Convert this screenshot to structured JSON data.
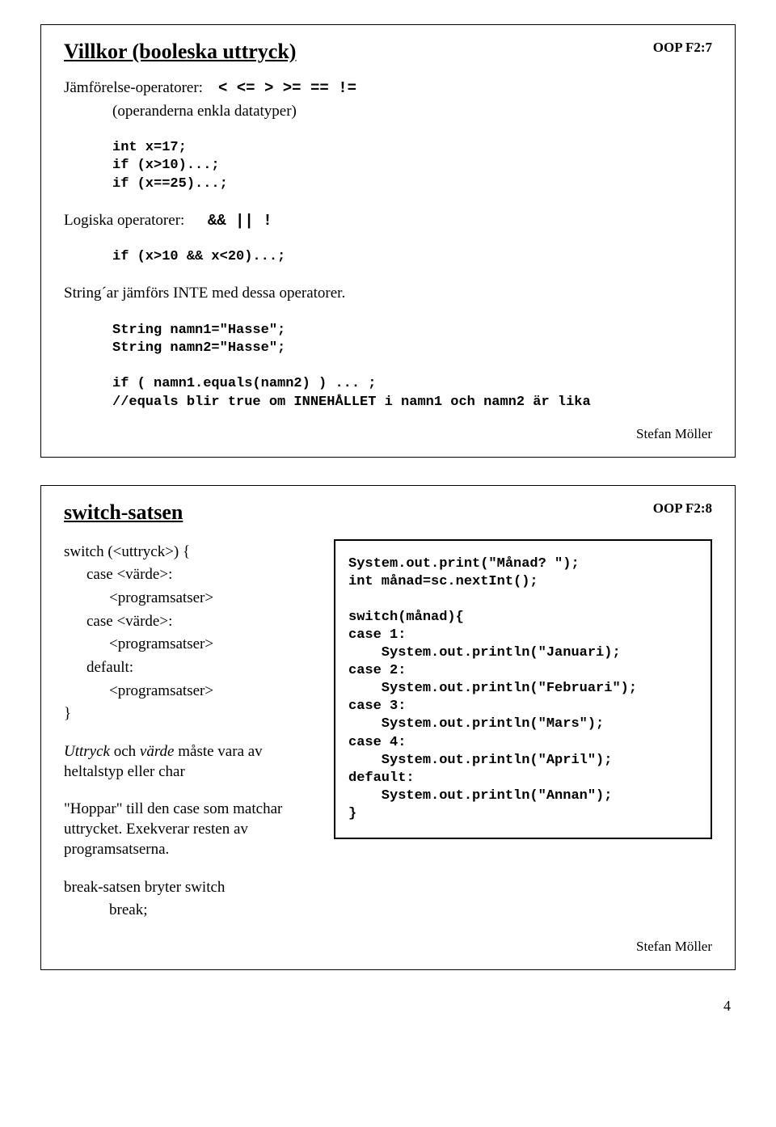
{
  "box1": {
    "tag": "OOP F2:7",
    "heading": "Villkor (booleska uttryck)",
    "line_compare_label": "Jämförelse-operatorer:",
    "line_compare_ops": "<   <=   >   >=   ==   !=",
    "line_operands": "(operanderna enkla datatyper)",
    "code1": "int x=17;\nif (x>10)...;\nif (x==25)...;",
    "line_logical_label": "Logiska operatorer:",
    "line_logical_ops": "&&   ||   !",
    "code2": "if (x>10 && x<20)...;",
    "line_string_note": "String´ar jämförs INTE med dessa operatorer.",
    "code3": "String namn1=\"Hasse\";\nString namn2=\"Hasse\";\n\nif ( namn1.equals(namn2) ) ... ;\n//equals blir true om INNEHÅLLET i namn1 och namn2 är lika",
    "author": "Stefan Möller"
  },
  "box2": {
    "tag": "OOP F2:8",
    "heading": "switch-satsen",
    "left": {
      "l1": "switch (<uttryck>) {",
      "l2": "case <värde>:",
      "l3": "<programsatser>",
      "l4": "case <värde>:",
      "l5": "<programsatser>",
      "l6": "default:",
      "l7": "<programsatser>",
      "l8": "}",
      "p2a": "Uttryck",
      "p2b": " och ",
      "p2c": "värde",
      "p2d": " måste vara av heltalstyp eller char",
      "p3": "\"Hoppar\" till den case som matchar uttrycket. Exekverar resten av programsatserna.",
      "p4": "break-satsen bryter switch",
      "p5": "break;"
    },
    "code": "System.out.print(\"Månad? \");\nint månad=sc.nextInt();\n\nswitch(månad){\ncase 1:\n    System.out.println(\"Januari);\ncase 2:\n    System.out.println(\"Februari\");\ncase 3:\n    System.out.println(\"Mars\");\ncase 4:\n    System.out.println(\"April\");\ndefault:\n    System.out.println(\"Annan\");\n}",
    "author": "Stefan Möller"
  },
  "page_number": "4"
}
